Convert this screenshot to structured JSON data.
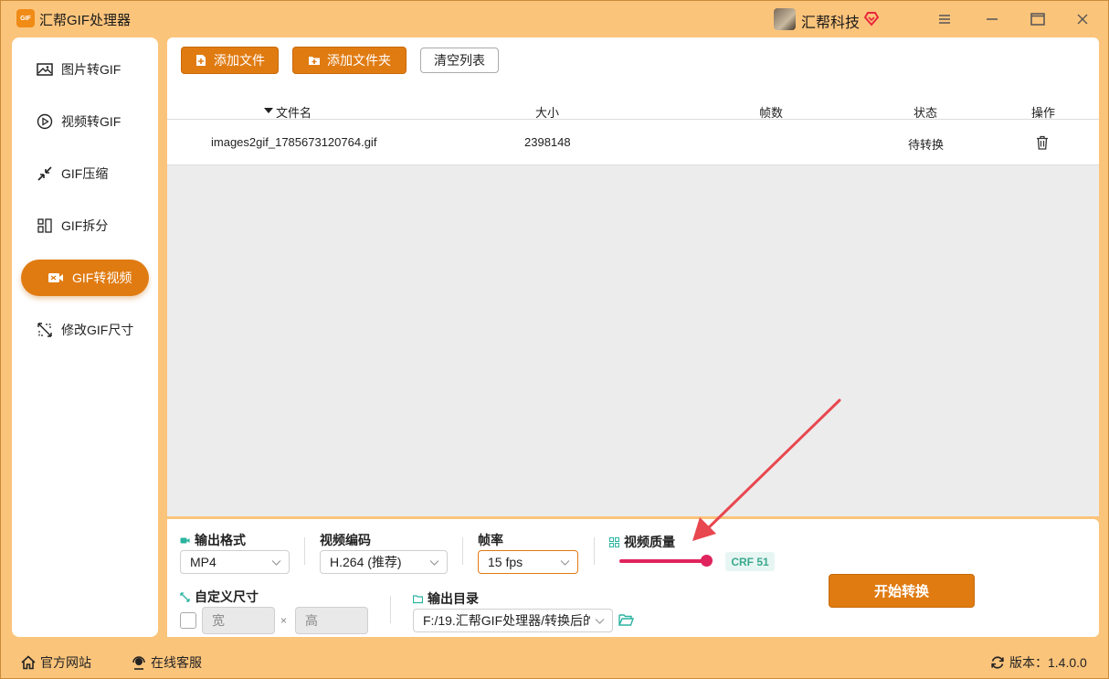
{
  "app": {
    "logo_text": "GIF",
    "title": "汇帮GIF处理器"
  },
  "user": {
    "name": "汇帮科技"
  },
  "sidebar": {
    "items": [
      {
        "label": "图片转GIF",
        "icon": "image-icon"
      },
      {
        "label": "视频转GIF",
        "icon": "play-circle-icon"
      },
      {
        "label": "GIF压缩",
        "icon": "compress-icon"
      },
      {
        "label": "GIF拆分",
        "icon": "split-icon"
      },
      {
        "label": "GIF转视频",
        "icon": "video-camera-icon",
        "active": true
      },
      {
        "label": "修改GIF尺寸",
        "icon": "resize-icon"
      }
    ]
  },
  "toolbar": {
    "add_file": "添加文件",
    "add_folder": "添加文件夹",
    "clear_list": "清空列表"
  },
  "table": {
    "headers": {
      "name": "文件名",
      "size": "大小",
      "frames": "帧数",
      "status": "状态",
      "action": "操作"
    },
    "rows": [
      {
        "name": "images2gif_1785673120764.gif",
        "size": "2398148",
        "frames": "",
        "status": "待转换"
      }
    ]
  },
  "settings": {
    "output_format": {
      "label": "输出格式",
      "value": "MP4"
    },
    "video_codec": {
      "label": "视频编码",
      "value": "H.264 (推荐)"
    },
    "frame_rate": {
      "label": "帧率",
      "value": "15 fps"
    },
    "video_quality": {
      "label": "视频质量",
      "badge": "CRF 51",
      "level": 1.0
    },
    "custom_size": {
      "label": "自定义尺寸",
      "width_placeholder": "宽",
      "height_placeholder": "高",
      "times": "×"
    },
    "output_dir": {
      "label": "输出目录",
      "value": "F:/19.汇帮GIF处理器/转换后的"
    },
    "start_button": "开始转换"
  },
  "footer": {
    "website": "官方网站",
    "support": "在线客服",
    "version": "版本：1.4.0.0"
  },
  "colors": {
    "accent": "#e07b12",
    "window_bg": "#fbc47b",
    "slider": "#e0245e",
    "crf": "#3aa88e",
    "annotation": "#e8474f"
  }
}
